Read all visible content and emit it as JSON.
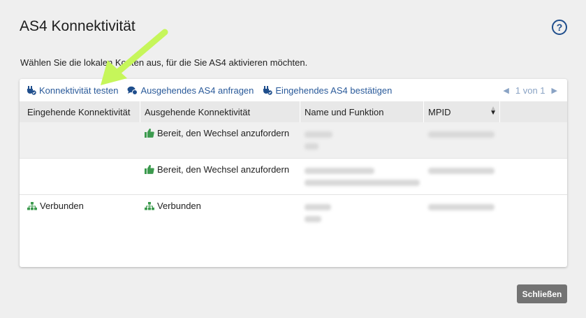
{
  "dialog": {
    "title": "AS4 Konnektivität",
    "intro": "Wählen Sie die lokalen Konten aus, für die Sie AS4 aktivieren möchten.",
    "close_label": "Schließen"
  },
  "toolbar": {
    "test_label": "Konnektivität testen",
    "outgoing_label": "Ausgehendes AS4 anfragen",
    "incoming_label": "Eingehendes AS4 bestätigen"
  },
  "pager": {
    "text": "1 von 1"
  },
  "columns": [
    "Eingehende Konnektivität",
    "Ausgehende Konnektivität",
    "Name und Funktion",
    "MPID"
  ],
  "rows": [
    {
      "incoming": "",
      "outgoing": "Bereit, den Wechsel anzufordern",
      "outgoing_icon": "thumbs-up-icon"
    },
    {
      "incoming": "",
      "outgoing": "Bereit, den Wechsel anzufordern",
      "outgoing_icon": "thumbs-up-icon"
    },
    {
      "incoming": "Verbunden",
      "incoming_icon": "network-icon",
      "outgoing": "Verbunden",
      "outgoing_icon": "network-icon"
    }
  ],
  "colors": {
    "link": "#2a5a9a",
    "success": "#3c9a4e",
    "annotation_arrow": "#c6f65a",
    "close_button": "#737373"
  }
}
